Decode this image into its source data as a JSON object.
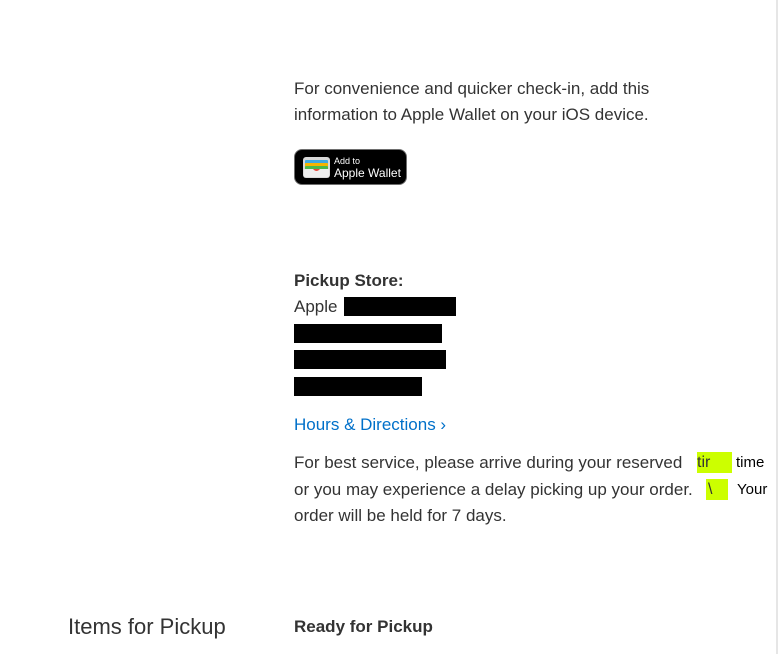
{
  "wallet": {
    "line1": "For convenience and quicker check-in, add this",
    "line2": "information to Apple Wallet on your iOS device.",
    "button_small": "Add to",
    "button_large": "Apple Wallet",
    "icon": "wallet-icon"
  },
  "store": {
    "label": "Pickup Store:",
    "name_prefix": "Apple"
  },
  "hours_link": "Hours & Directions ›",
  "service": {
    "line1": "For best service, please arrive during your reserved",
    "highlight1": "tir",
    "after1": "time",
    "line2": "or you may experience a delay picking up your order.",
    "highlight2": "\\",
    "after2": "Your",
    "line3": "order will be held for 7 days."
  },
  "items": {
    "title": "Items for Pickup",
    "status": "Ready for Pickup"
  },
  "colors": {
    "link": "#0070c9",
    "highlight": "#ccff00",
    "text": "#333333"
  }
}
